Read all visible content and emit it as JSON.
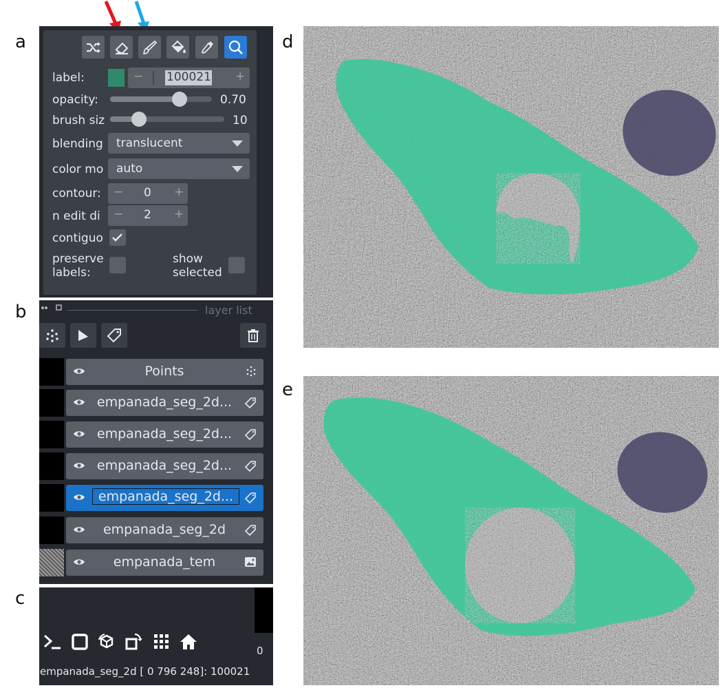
{
  "panel_letters": {
    "a": "a",
    "b": "b",
    "c": "c",
    "d": "d",
    "e": "e"
  },
  "toolbar": {
    "tools": [
      "shuffle-icon",
      "eraser-icon",
      "paintbrush-icon",
      "fill-bucket-icon",
      "color-picker-icon",
      "zoom-icon"
    ],
    "active_tool": "zoom-icon",
    "arrow_colors": {
      "red": "#e8141b",
      "blue": "#1fa8e4"
    }
  },
  "controls": {
    "label": {
      "text": "label:",
      "minus": "−",
      "value": "100021",
      "plus": "+",
      "swatch_color": "#2e8a6a"
    },
    "opacity": {
      "text": "opacity:",
      "value": "0.70",
      "level": 0.7
    },
    "brush_size": {
      "text": "brush siz",
      "value": "10"
    },
    "blending": {
      "text": "blending",
      "value": "translucent"
    },
    "color_mode": {
      "text": "color mo",
      "value": "auto"
    },
    "contour": {
      "text": "contour:",
      "minus": "−",
      "value": "0",
      "plus": "+"
    },
    "n_edit_dim": {
      "text": "n edit di",
      "minus": "−",
      "value": "2",
      "plus": "+"
    },
    "contiguous": {
      "text": "contiguo",
      "checked": true
    },
    "preserve_labels": {
      "line1": "preserve",
      "line2": "labels:",
      "checked": false
    },
    "show_selected": {
      "line1": "show",
      "line2": "selected",
      "checked": false
    }
  },
  "layer_list": {
    "title": "layer list",
    "buttons": [
      "new-points-icon",
      "new-shapes-icon",
      "new-labels-icon",
      "delete-layer-icon"
    ],
    "layers": [
      {
        "name": "Points",
        "type": "points-icon",
        "selected": false
      },
      {
        "name": "empanada_seg_2d...",
        "type": "labels-icon",
        "selected": false
      },
      {
        "name": "empanada_seg_2d...",
        "type": "labels-icon",
        "selected": false
      },
      {
        "name": "empanada_seg_2d...",
        "type": "labels-icon",
        "selected": false
      },
      {
        "name": "empanada_seg_2d...",
        "type": "labels-icon",
        "selected": true
      },
      {
        "name": "empanada_seg_2d",
        "type": "labels-icon",
        "selected": false
      },
      {
        "name": "empanada_tem",
        "type": "image-icon",
        "selected": false
      }
    ]
  },
  "viewer_buttons": [
    "console-icon",
    "ndisplay-icon",
    "roll-icon",
    "transpose-icon",
    "grid-icon",
    "home-icon"
  ],
  "viewer_counter": "0",
  "status_bar": "empanada_seg_2d [ 0 796 248]: 100021",
  "colors": {
    "segment": "#3ec79a",
    "mito": "#4f4d6b"
  }
}
